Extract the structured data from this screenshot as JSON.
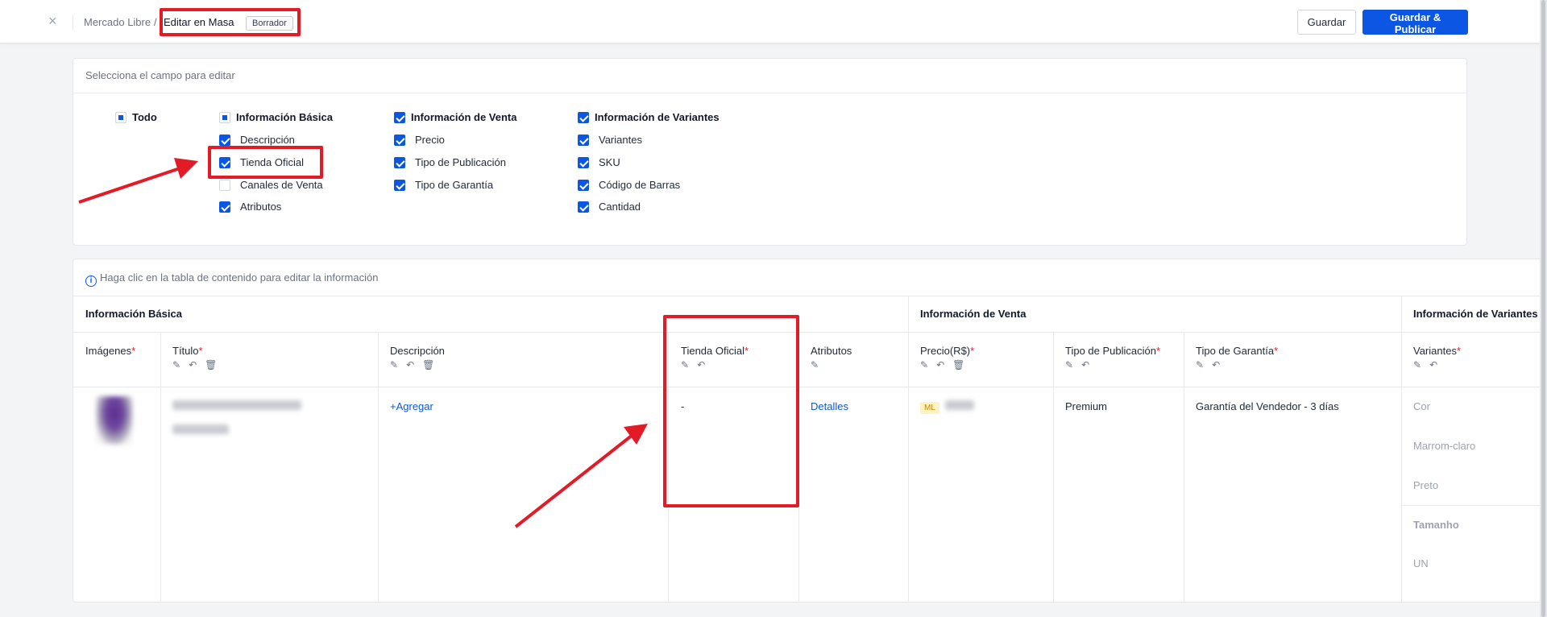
{
  "header": {
    "close_glyph": "×",
    "breadcrumb_root": "Mercado Libre",
    "breadcrumb_sep": "/",
    "breadcrumb_current": "Editar en Masa",
    "status_badge": "Borrador",
    "save_label": "Guardar",
    "publish_label": "Guardar & Publicar"
  },
  "selector": {
    "title": "Selecciona el campo para editar",
    "all_label": "Todo",
    "groups": [
      {
        "label": "Información Básica",
        "state": "partial",
        "items": [
          {
            "label": "Descripción",
            "checked": true
          },
          {
            "label": "Tienda Oficial",
            "checked": true
          },
          {
            "label": "Canales de Venta",
            "checked": false
          },
          {
            "label": "Atributos",
            "checked": true
          }
        ]
      },
      {
        "label": "Información de Venta",
        "state": "checked",
        "items": [
          {
            "label": "Precio",
            "checked": true
          },
          {
            "label": "Tipo de Publicación",
            "checked": true
          },
          {
            "label": "Tipo de Garantía",
            "checked": true
          }
        ]
      },
      {
        "label": "Información de Variantes",
        "state": "checked",
        "items": [
          {
            "label": "Variantes",
            "checked": true
          },
          {
            "label": "SKU",
            "checked": true
          },
          {
            "label": "Código de Barras",
            "checked": true
          },
          {
            "label": "Cantidad",
            "checked": true
          }
        ]
      }
    ]
  },
  "table": {
    "info": "Haga clic en la tabla de contenido para editar la información",
    "group_headers": {
      "basic": "Información Básica",
      "sale": "Información de Venta",
      "variants": "Información de Variantes"
    },
    "columns": {
      "images": "Imágenes",
      "title": "Título",
      "description": "Descripción",
      "official_store": "Tienda Oficial",
      "attributes": "Atributos",
      "price": "Precio(R$)",
      "publication_type": "Tipo de Publicación",
      "warranty_type": "Tipo de Garantía",
      "variants": "Variantes"
    },
    "required_mark": "*",
    "row": {
      "description_action": "+Agregar",
      "official_store": "-",
      "attributes_link": "Detalles",
      "price_tag": "ML",
      "publication_type": "Premium",
      "warranty_type": "Garantía del Vendedor - 3 días",
      "variant_lines": [
        "Cor",
        "Marrom-claro",
        "Preto",
        "Tamanho",
        "UN"
      ]
    }
  },
  "colors": {
    "primary": "#0b57e3",
    "annotation_red": "#e21b26",
    "required_red": "#e21b26"
  }
}
